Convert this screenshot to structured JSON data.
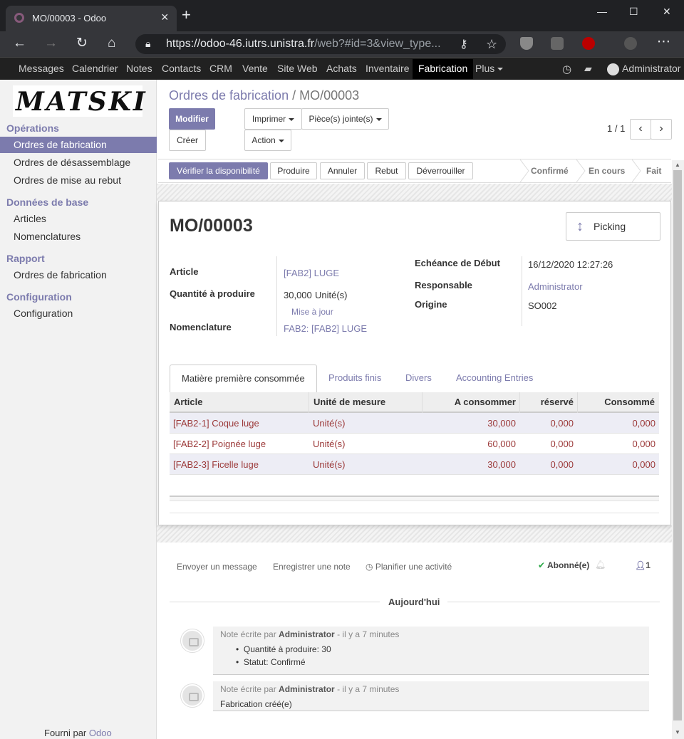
{
  "browser": {
    "tab_title": "MO/00003 - Odoo",
    "url_host": "https://odoo-46.iutrs.unistra.fr",
    "url_path": "/web?#id=3&view_type...",
    "new_tab": "+",
    "minimize": "—",
    "maximize": "☐",
    "close": "✕"
  },
  "menu": {
    "items": [
      "Messages",
      "Calendrier",
      "Notes",
      "Contacts",
      "CRM",
      "Vente",
      "Site Web",
      "Achats",
      "Inventaire",
      "Fabrication",
      "Plus"
    ],
    "user": "Administrator"
  },
  "sidebar": {
    "logo_text": "MATSKI",
    "sections": [
      {
        "title": "Opérations",
        "items": [
          "Ordres de fabrication",
          "Ordres de désassemblage",
          "Ordres de mise au rebut"
        ]
      },
      {
        "title": "Données de base",
        "items": [
          "Articles",
          "Nomenclatures"
        ]
      },
      {
        "title": "Rapport",
        "items": [
          "Ordres de fabrication"
        ]
      },
      {
        "title": "Configuration",
        "items": [
          "Configuration"
        ]
      }
    ],
    "powered_prefix": "Fourni par ",
    "powered_brand": "Odoo"
  },
  "breadcrumb": {
    "parent": "Ordres de fabrication",
    "separator": "/",
    "current": "MO/00003"
  },
  "toolbar": {
    "modify": "Modifier",
    "create": "Créer",
    "print": "Imprimer",
    "attachments": "Pièce(s) jointe(s)",
    "action": "Action",
    "pager": "1 / 1"
  },
  "header_buttons": {
    "check": "Vérifier la disponibilité",
    "produce": "Produire",
    "cancel": "Annuler",
    "scrap": "Rebut",
    "unlock": "Déverrouiller"
  },
  "stages": [
    "Confirmé",
    "En cours",
    "Fait"
  ],
  "form": {
    "name": "MO/00003",
    "smart_button": "Picking",
    "article_label": "Article",
    "article_value": "[FAB2] LUGE",
    "qty_label": "Quantité à produire",
    "qty_value": "30,000",
    "qty_unit": "Unité(s)",
    "update_link": "Mise à jour",
    "bom_label": "Nomenclature",
    "bom_value": "FAB2: [FAB2] LUGE",
    "deadline_label": "Echéance de Début",
    "deadline_value": "16/12/2020 12:27:26",
    "responsible_label": "Responsable",
    "responsible_value": "Administrator",
    "origin_label": "Origine",
    "origin_value": "SO002"
  },
  "tabs": [
    "Matière première consommée",
    "Produits finis",
    "Divers",
    "Accounting Entries"
  ],
  "table": {
    "headers": [
      "Article",
      "Unité de mesure",
      "A consommer",
      "réservé",
      "Consommé"
    ],
    "rows": [
      [
        "[FAB2-1] Coque luge",
        "Unité(s)",
        "30,000",
        "0,000",
        "0,000"
      ],
      [
        "[FAB2-2] Poignée luge",
        "Unité(s)",
        "60,000",
        "0,000",
        "0,000"
      ],
      [
        "[FAB2-3] Ficelle luge",
        "Unité(s)",
        "30,000",
        "0,000",
        "0,000"
      ]
    ]
  },
  "chatter": {
    "send_message": "Envoyer un message",
    "log_note": "Enregistrer une note",
    "schedule": "Planifier une activité",
    "follow": "Abonné(e)",
    "followers": "1",
    "day": "Aujourd'hui",
    "messages": [
      {
        "prefix": "Note écrite par ",
        "author": "Administrator",
        "time": " - il y a 7 minutes",
        "lines": [
          "Quantité à produire: 30",
          "Statut: Confirmé"
        ]
      },
      {
        "prefix": "Note écrite par ",
        "author": "Administrator",
        "time": " - il y a 7 minutes",
        "text": "Fabrication créé(e)"
      }
    ]
  },
  "colors": {
    "brand": "#7c7bad",
    "odoo_purple": "#875a7b",
    "link_red": "#9c3a3a"
  }
}
